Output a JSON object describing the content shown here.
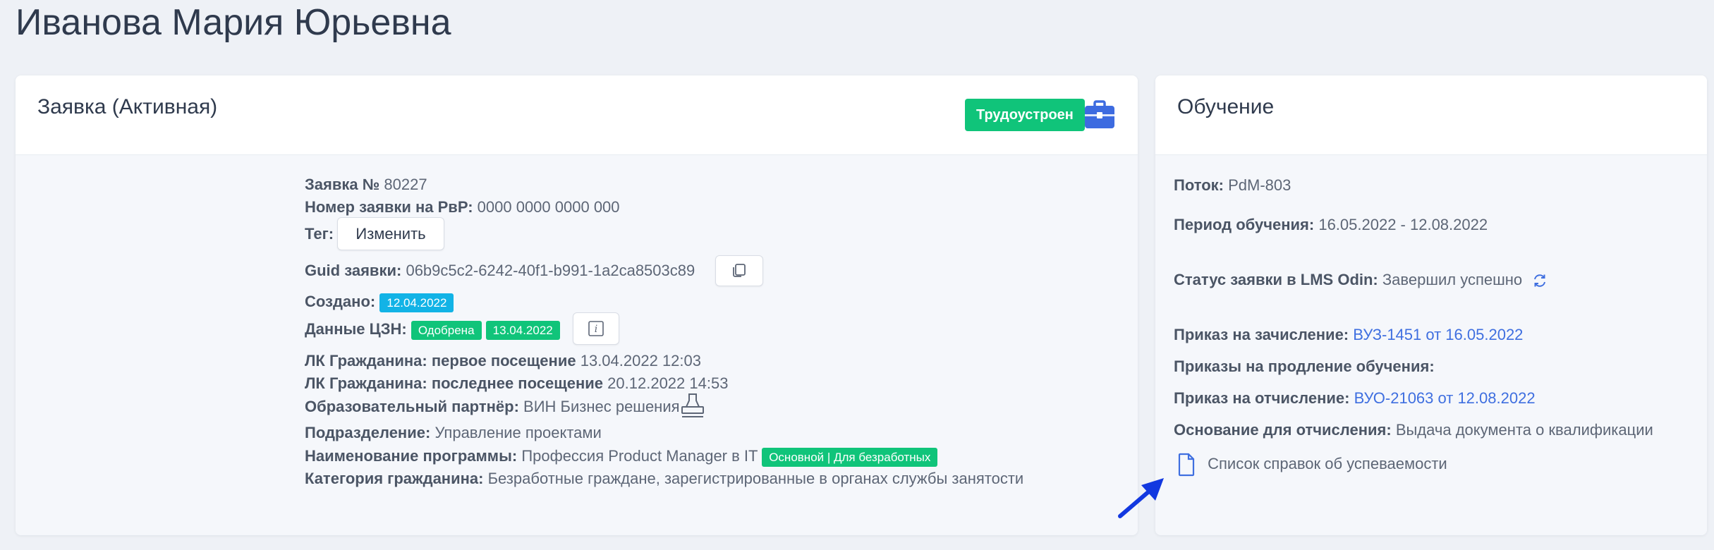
{
  "page": {
    "title": "Иванова Мария Юрьевна"
  },
  "application_card": {
    "title": "Заявка (Активная)",
    "status_badge": "Трудоустроен",
    "number_label": "Заявка №",
    "number_value": "80227",
    "rvr_label": "Номер заявки на РвР:",
    "rvr_value": "0000 0000 0000 000",
    "tag_label": "Тег:",
    "change_button": "Изменить",
    "guid_label": "Guid заявки:",
    "guid_value": "06b9c5c2-6242-40f1-b991-1a2ca8503c89",
    "created_label": "Создано:",
    "created_value": "12.04.2022",
    "czn_label": "Данные ЦЗН:",
    "czn_status": "Одобрена",
    "czn_date": "13.04.2022",
    "first_visit_label": "ЛК Гражданина: первое посещение",
    "first_visit_value": "13.04.2022 12:03",
    "last_visit_label": "ЛК Гражданина: последнее посещение",
    "last_visit_value": "20.12.2022 14:53",
    "partner_label": "Образовательный партнёр:",
    "partner_value": "ВИН Бизнес решения",
    "division_label": "Подразделение:",
    "division_value": "Управление проектами",
    "program_label": "Наименование программы:",
    "program_value": "Профессия Product Manager в IT",
    "program_badge": "Основной | Для безработных",
    "category_label": "Категория гражданина:",
    "category_value": "Безработные граждане, зарегистрированные в органах службы занятости"
  },
  "training_card": {
    "title": "Обучение",
    "stream_label": "Поток:",
    "stream_value": "PdM-803",
    "period_label": "Период обучения:",
    "period_value": "16.05.2022 - 12.08.2022",
    "lms_label": "Статус заявки в LMS Odin:",
    "lms_value": "Завершил успешно",
    "enroll_label": "Приказ на зачисление:",
    "enroll_link": "ВУЗ-1451 от 16.05.2022",
    "extension_label": "Приказы на продление обучения:",
    "expel_label": "Приказ на отчисление:",
    "expel_link": "ВУО-21063 от 12.08.2022",
    "reason_label": "Основание для отчисления:",
    "reason_value": "Выдача документа о квалификации",
    "certificates_link": "Список справок об успеваемости"
  },
  "colors": {
    "green": "#10c47a",
    "blue_badge": "#12b3e6",
    "link": "#3f6fe0",
    "briefcase": "#3d6be0",
    "arrow": "#1238e0"
  },
  "icons": [
    "briefcase-icon",
    "copy-icon",
    "info-icon",
    "stamp-icon",
    "refresh-icon",
    "document-icon",
    "arrow-pointer-icon"
  ]
}
